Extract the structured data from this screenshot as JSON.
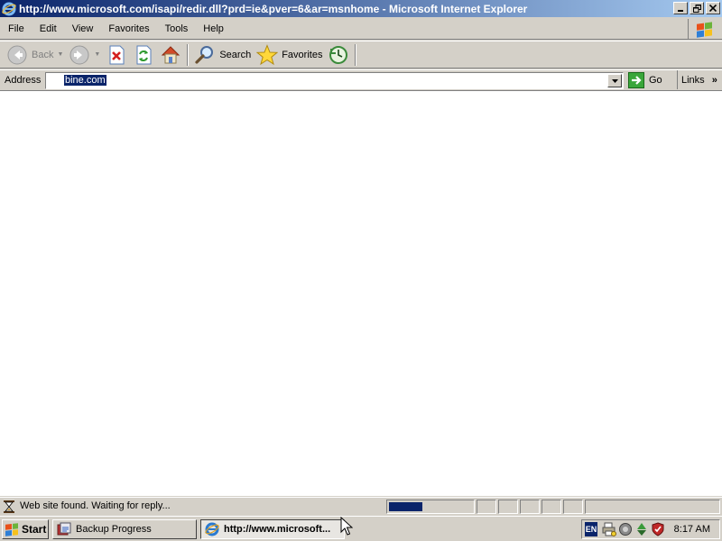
{
  "window": {
    "title": "http://www.microsoft.com/isapi/redir.dll?prd=ie&pver=6&ar=msnhome - Microsoft Internet Explorer",
    "caption_buttons": [
      "minimize",
      "restore",
      "close"
    ]
  },
  "menu": {
    "items": [
      "File",
      "Edit",
      "View",
      "Favorites",
      "Tools",
      "Help"
    ]
  },
  "toolbar": {
    "back_label": "Back",
    "search_label": "Search",
    "favorites_label": "Favorites"
  },
  "address_bar": {
    "label": "Address",
    "value": "bine.com",
    "go_label": "Go",
    "links_label": "Links",
    "links_chevron": "»"
  },
  "status_bar": {
    "text": "Web site found. Waiting for reply...",
    "progress_fraction": 0.4
  },
  "taskbar": {
    "start_label": "Start",
    "tasks": [
      {
        "label": "Backup Progress",
        "active": false
      },
      {
        "label": "http://www.microsoft...",
        "active": true
      }
    ],
    "language": "EN",
    "clock": "8:17 AM"
  },
  "colors": {
    "titlebar_start": "#0a246a",
    "titlebar_end": "#a6caf0",
    "chrome": "#d4d0c8",
    "selection": "#0a246a"
  },
  "icons": [
    "ie-icon",
    "windows-flag-icon",
    "back-arrow-icon",
    "forward-arrow-icon",
    "stop-icon",
    "refresh-icon",
    "home-icon",
    "search-icon",
    "favorites-star-icon",
    "history-icon",
    "go-arrow-icon",
    "hourglass-icon",
    "backup-icon",
    "printer-icon",
    "network-icon",
    "recycle-icon",
    "shield-icon",
    "mouse-cursor-icon"
  ]
}
